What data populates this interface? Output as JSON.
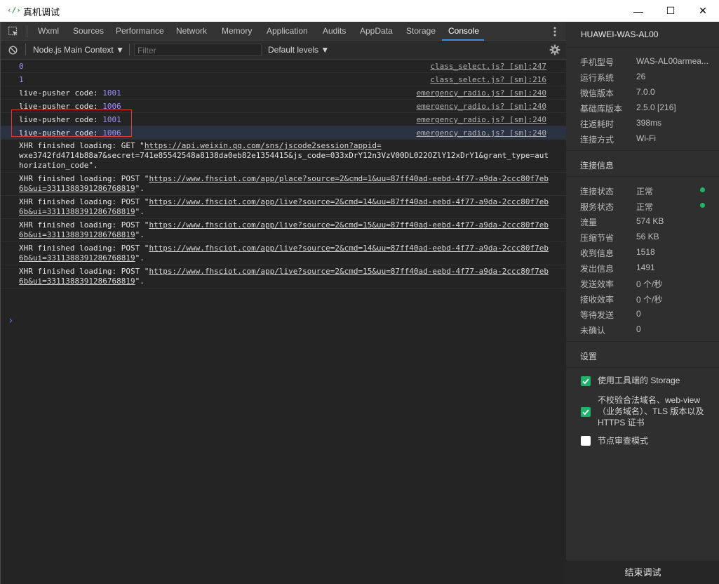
{
  "window": {
    "title": "真机调试",
    "app_icon": "‹/›",
    "minimize": "—",
    "maximize": "☐",
    "close": "✕"
  },
  "tabs": [
    "Wxml",
    "Sources",
    "Performance",
    "Network",
    "Memory",
    "Application",
    "Audits",
    "AppData",
    "Storage",
    "Console"
  ],
  "active_tab": "Console",
  "toolbar": {
    "context": "Node.js Main Context",
    "filter_placeholder": "Filter",
    "levels": "Default levels"
  },
  "console": {
    "rows": [
      {
        "a": "0",
        "src": "class_select.js? [sm]:247"
      },
      {
        "a": "1",
        "src": "class_select.js? [sm]:216"
      },
      {
        "a": "live-pusher code: ",
        "b": "1001",
        "src": "emergency_radio.js? [sm]:240"
      },
      {
        "a": "live-pusher code: ",
        "b": "1006",
        "src": "emergency_radio.js? [sm]:240"
      },
      {
        "a": "live-pusher code: ",
        "b": "1001",
        "src": "emergency_radio.js? [sm]:240"
      },
      {
        "a": "live-pusher code: ",
        "b": "1006",
        "src": "emergency_radio.js? [sm]:240"
      }
    ],
    "xhr": [
      {
        "pre": "XHR finished loading: GET \"",
        "l1": "https://api.weixin.qq.com/sns/jscode2session?appid=",
        "l2": "wxe3742fd4714b88a7&secret=741e85542548a8138da0eb82e1354415&js_code=033xDrY12n3VzV00DL022OZlY12xDrY1&grant_type=aut",
        "l3": "horization_code",
        "post": "\"."
      },
      {
        "pre": "XHR finished loading: POST \"",
        "l1": "https://www.fhsciot.com/app/place?source=2&cmd=1&uu=87ff40ad-eebd-4f77-a9da-2ccc80f7eb",
        "l2": "6b&ui=3311388391286768819",
        "post": "\"."
      },
      {
        "pre": "XHR finished loading: POST \"",
        "l1": "https://www.fhsciot.com/app/live?source=2&cmd=14&uu=87ff40ad-eebd-4f77-a9da-2ccc80f7eb",
        "l2": "6b&ui=3311388391286768819",
        "post": "\"."
      },
      {
        "pre": "XHR finished loading: POST \"",
        "l1": "https://www.fhsciot.com/app/live?source=2&cmd=15&uu=87ff40ad-eebd-4f77-a9da-2ccc80f7eb",
        "l2": "6b&ui=3311388391286768819",
        "post": "\"."
      },
      {
        "pre": "XHR finished loading: POST \"",
        "l1": "https://www.fhsciot.com/app/live?source=2&cmd=14&uu=87ff40ad-eebd-4f77-a9da-2ccc80f7eb",
        "l2": "6b&ui=3311388391286768819",
        "post": "\"."
      },
      {
        "pre": "XHR finished loading: POST \"",
        "l1": "https://www.fhsciot.com/app/live?source=2&cmd=15&uu=87ff40ad-eebd-4f77-a9da-2ccc80f7eb",
        "l2": "6b&ui=3311388391286768819",
        "post": "\"."
      }
    ],
    "prompt": "›"
  },
  "panel": {
    "device": "HUAWEI-WAS-AL00",
    "info": [
      {
        "label": "手机型号",
        "value": "WAS-AL00armea..."
      },
      {
        "label": "运行系统",
        "value": "26"
      },
      {
        "label": "微信版本",
        "value": "7.0.0"
      },
      {
        "label": "基础库版本",
        "value": "2.5.0 [216]"
      },
      {
        "label": "往返耗时",
        "value": "398ms"
      },
      {
        "label": "连接方式",
        "value": "Wi-Fi"
      }
    ],
    "conn_title": "连接信息",
    "conn": [
      {
        "label": "连接状态",
        "value": "正常"
      },
      {
        "label": "服务状态",
        "value": "正常"
      },
      {
        "label": "流量",
        "value": "574 KB"
      },
      {
        "label": "压缩节省",
        "value": "56 KB"
      },
      {
        "label": "收到信息",
        "value": "1518"
      },
      {
        "label": "发出信息",
        "value": "1491"
      },
      {
        "label": "发送效率",
        "value": "0 个/秒"
      },
      {
        "label": "接收效率",
        "value": "0 个/秒"
      },
      {
        "label": "等待发送",
        "value": "0"
      },
      {
        "label": "未确认",
        "value": "0"
      }
    ],
    "status_color": "#1fb36a",
    "settings_title": "设置",
    "settings": [
      {
        "label": "使用工具端的 Storage",
        "checked": true
      },
      {
        "label": "不校验合法域名、web-view（业务域名）、TLS 版本以及 HTTPS 证书",
        "checked": true
      },
      {
        "label": "节点审查模式",
        "checked": false
      }
    ],
    "end_button": "结束调试"
  }
}
